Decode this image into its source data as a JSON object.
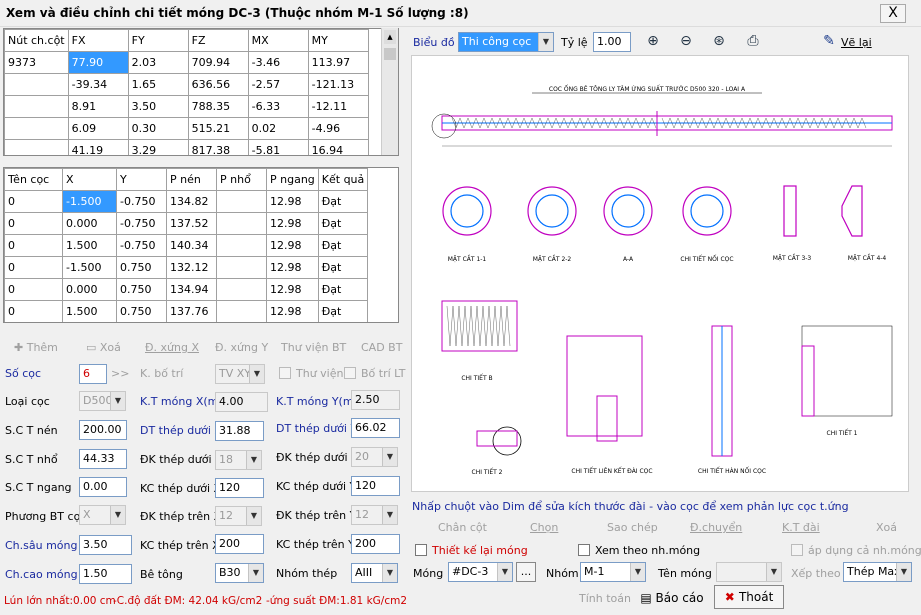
{
  "window": {
    "title": "Xem và điều chỉnh chi tiết móng DC-3 (Thuộc nhóm M-1 Số lượng :8)",
    "close": "X"
  },
  "force_table": {
    "headers": [
      "Nút ch.cột",
      "FX",
      "FY",
      "FZ",
      "MX",
      "MY"
    ],
    "rows": [
      [
        "9373",
        "77.90",
        "2.03",
        "709.94",
        "-3.46",
        "113.97"
      ],
      [
        "",
        "-39.34",
        "1.65",
        "636.56",
        "-2.57",
        "-121.13"
      ],
      [
        "",
        "8.91",
        "3.50",
        "788.35",
        "-6.33",
        "-12.11"
      ],
      [
        "",
        "6.09",
        "0.30",
        "515.21",
        "0.02",
        "-4.96"
      ],
      [
        "",
        "41.19",
        "3.29",
        "817.38",
        "-5.81",
        "16.94"
      ]
    ]
  },
  "pile_table": {
    "headers": [
      "Tên cọc",
      "X",
      "Y",
      "P nén",
      "P nhổ",
      "P ngang",
      "Kết quả"
    ],
    "rows": [
      [
        "0",
        "-1.500",
        "-0.750",
        "134.82",
        "",
        "12.98",
        "Đạt"
      ],
      [
        "0",
        "0.000",
        "-0.750",
        "137.52",
        "",
        "12.98",
        "Đạt"
      ],
      [
        "0",
        "1.500",
        "-0.750",
        "140.34",
        "",
        "12.98",
        "Đạt"
      ],
      [
        "0",
        "-1.500",
        "0.750",
        "132.12",
        "",
        "12.98",
        "Đạt"
      ],
      [
        "0",
        "0.000",
        "0.750",
        "134.94",
        "",
        "12.98",
        "Đạt"
      ],
      [
        "0",
        "1.500",
        "0.750",
        "137.76",
        "",
        "12.98",
        "Đạt"
      ]
    ]
  },
  "pile_toolbar": {
    "add": "Thêm",
    "delete": "Xoá",
    "sym_x": "Đ. xứng X",
    "sym_y": "Đ. xứng Y",
    "library": "Thư viện BT",
    "cad": "CAD BT"
  },
  "form": {
    "so_coc_label": "Số cọc",
    "so_coc_value": "6",
    "so_coc_arrow": ">>",
    "k_bo_tri_label": "K. bố trí",
    "k_bo_tri_value": "TV XY",
    "thu_vien_label": "Thư viện",
    "bo_tri_lt_label": "Bố trí LT",
    "loai_coc_label": "Loại cọc",
    "loai_coc_value": "D500",
    "kt_mong_x_label": "K.T móng X(m)",
    "kt_mong_x_value": "4.00",
    "kt_mong_y_label": "K.T móng Y(m)",
    "kt_mong_y_value": "2.50",
    "sct_nen_label": "S.C T nén",
    "sct_nen_value": "200.00",
    "dt_thep_x_label": "DT thép dưới X",
    "dt_thep_x_value": "31.88",
    "dt_thep_y_label": "DT thép dưới Y",
    "dt_thep_y_value": "66.02",
    "sct_nho_label": "S.C T nhổ",
    "sct_nho_value": "44.33",
    "dk_thep_duoi_x_label": "ĐK thép dưới X",
    "dk_thep_duoi_x_value": "18",
    "dk_thep_duoi_y_label": "ĐK thép dưới Y",
    "dk_thep_duoi_y_value": "20",
    "sct_ngang_label": "S.C T ngang",
    "sct_ngang_value": "0.00",
    "kc_thep_duoi_x_label": "KC thép dưới X",
    "kc_thep_duoi_x_value": "120",
    "kc_thep_duoi_y_label": "KC thép dưới Y",
    "kc_thep_duoi_y_value": "120",
    "phuong_bt_label": "Phương BT cọc",
    "phuong_bt_value": "X",
    "dk_thep_tren_x_label": "ĐK thép trên X",
    "dk_thep_tren_x_value": "12",
    "dk_thep_tren_y_label": "ĐK thép trên Y",
    "dk_thep_tren_y_value": "12",
    "ch_sau_label": "Ch.sâu móng",
    "ch_sau_value": "3.50",
    "kc_thep_tren_x_label": "KC thép trên X",
    "kc_thep_tren_x_value": "200",
    "kc_thep_tren_y_label": "KC thép trên Y",
    "kc_thep_tren_y_value": "200",
    "ch_cao_label": "Ch.cao móng",
    "ch_cao_value": "1.50",
    "be_tong_label": "Bê tông",
    "be_tong_value": "B30",
    "nhom_thep_label": "Nhóm thép",
    "nhom_thep_value": "AIII"
  },
  "status": {
    "lun": "Lún lớn nhất:0.00 cm",
    "c_do_dat": "-C.độ đất ĐM: 42.04 kG/cm2",
    "ung_suat": "-ứng suất ĐM:1.81 kG/cm2"
  },
  "drawing_toolbar": {
    "bieu_do_label": "Biểu đồ",
    "bieu_do_value": "Thi công cọc",
    "ty_le_label": "Tỷ lệ",
    "ty_le_value": "1.00",
    "ve_lai": "Vẽ lại"
  },
  "drawing": {
    "title": "COC ỐNG BÊ TÔNG LY TÂM ỨNG SUẤT TRƯỚC D500 320 - LOAI A",
    "labels": [
      "MẶT CẮT 1-1",
      "MẶT CẮT 2-2",
      "A-A",
      "CHI TIẾT NỐI CỌC",
      "MẶT CẮT 3-3",
      "MẶT CẮT 4-4",
      "CHI TIẾT B",
      "CHI TIẾT LIÊN KẾT ĐÀI CỌC",
      "CHI TIẾT HÀN NỐI CỌC",
      "CHI TIẾT 1",
      "CHI TIẾT 2"
    ]
  },
  "hint": "Nhấp chuột vào Dim để sửa kích thước đài - vào cọc để xem phản lực cọc t.ứng",
  "right_toolbar": {
    "chan_cot": "Chân cột",
    "chon": "Chọn",
    "sao_chep": "Sao chép",
    "d_chuyen": "Đ.chuyển",
    "kt_dai": "K.T đài",
    "xoa": "Xoá"
  },
  "options": {
    "thiet_ke_lai": "Thiết kế lại móng",
    "xem_theo_nhom": "Xem theo nh.móng",
    "ap_dung": "áp dụng cả nh.móng"
  },
  "bottom": {
    "mong_label": "Móng",
    "mong_value": "#DC-3",
    "mong_more": "...",
    "nhom_label": "Nhóm",
    "nhom_value": "M-1",
    "ten_mong_label": "Tên móng",
    "ten_mong_value": "",
    "xep_theo_label": "Xếp theo",
    "xep_theo_value": "Thép Max",
    "tinh_toan": "Tính toán",
    "bao_cao": "Báo cáo",
    "thoat": "Thoát"
  }
}
